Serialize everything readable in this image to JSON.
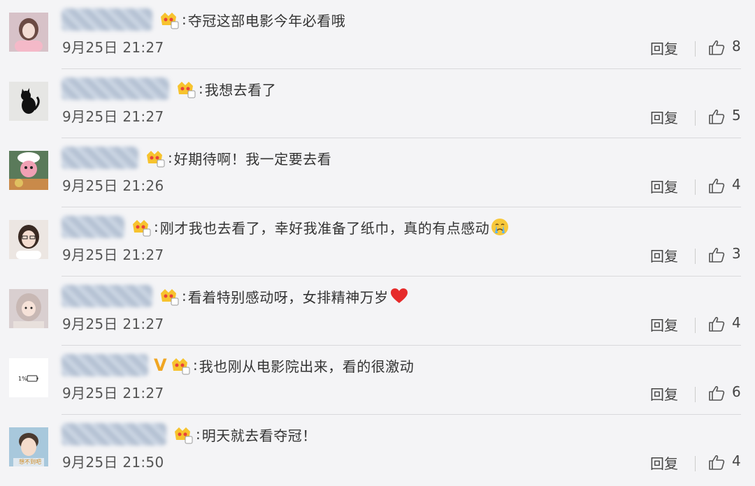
{
  "comments": [
    {
      "text": "夺冠这部电影今年必看哦",
      "time": "9月25日 21:27",
      "reply": "回复",
      "likes": "8",
      "emoji": "",
      "vip": false,
      "avatar": "pink-hair-girl"
    },
    {
      "text": "我想去看了",
      "time": "9月25日 21:27",
      "reply": "回复",
      "likes": "5",
      "emoji": "",
      "vip": false,
      "avatar": "black-cat"
    },
    {
      "text": "好期待啊！我一定要去看",
      "time": "9月25日 21:26",
      "reply": "回复",
      "likes": "4",
      "emoji": "",
      "vip": false,
      "avatar": "chef-food"
    },
    {
      "text": "刚才我也去看了，幸好我准备了纸巾，真的有点感动",
      "time": "9月25日 21:27",
      "reply": "回复",
      "likes": "3",
      "emoji": "crying-face",
      "vip": false,
      "avatar": "girl-glasses"
    },
    {
      "text": "看着特别感动呀，女排精神万岁",
      "time": "9月25日 21:27",
      "reply": "回复",
      "likes": "4",
      "emoji": "red-heart",
      "vip": false,
      "avatar": "girl-hood"
    },
    {
      "text": "我也刚从电影院出来，看的很激动",
      "time": "9月25日 21:27",
      "reply": "回复",
      "likes": "6",
      "emoji": "",
      "vip": true,
      "vip_mark": "V",
      "avatar": "battery-1-percent",
      "avatar_text": "1%"
    },
    {
      "text": "明天就去看夺冠！",
      "time": "9月25日 21:50",
      "reply": "回复",
      "likes": "4",
      "emoji": "",
      "vip": false,
      "avatar": "boy-caption",
      "avatar_text": "想不到吧"
    }
  ],
  "colors": {
    "background": "#f4f4f6",
    "text": "#333333",
    "vip": "#f0a623"
  }
}
